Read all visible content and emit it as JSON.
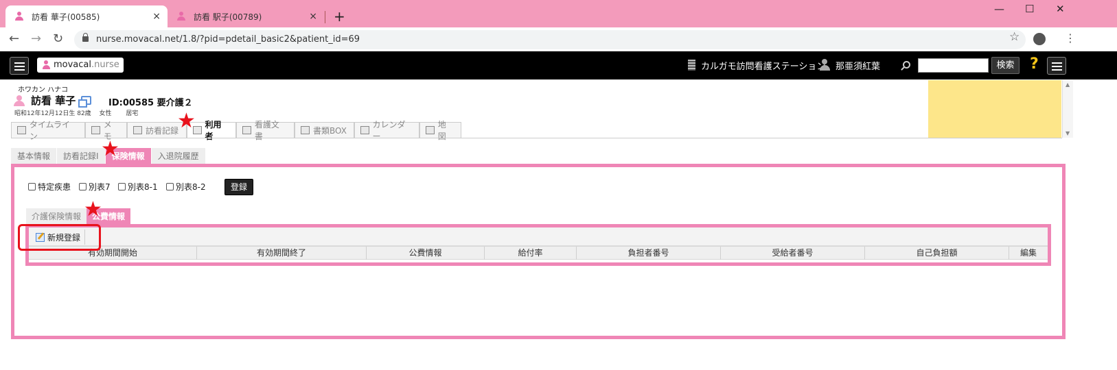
{
  "browser": {
    "tabs": [
      {
        "title": "訪看 華子(00585)",
        "close": "×"
      },
      {
        "title": "訪看 駅子(00789)",
        "close": "×"
      }
    ],
    "new_tab": "+",
    "window_controls": {
      "minimize": "—",
      "maximize": "☐",
      "close": "✕"
    },
    "nav": {
      "back": "←",
      "forward": "→",
      "reload": "↻"
    },
    "url": "nurse.movacal.net/1.8/?pid=pdetail_basic2&patient_id=69",
    "bookmark_star": "☆",
    "menu": "⋮"
  },
  "app": {
    "logo_main": "movacal",
    "logo_suffix": ".nurse",
    "station": "カルガモ訪問看護ステーション",
    "user": "那亜須紅葉",
    "search_button": "検索",
    "help": "?"
  },
  "patient": {
    "kana": "ホワカン ハナコ",
    "name": "訪看 華子",
    "id_care": "ID:00585 要介護２",
    "details": "昭和12年12月12日生 82歳　 女性　　 居宅"
  },
  "main_tabs": [
    {
      "label": "タイムライン",
      "active": false
    },
    {
      "label": "メモ",
      "active": false
    },
    {
      "label": "訪看記録",
      "active": false
    },
    {
      "label": "利用者",
      "active": true
    },
    {
      "label": "看護文書",
      "active": false
    },
    {
      "label": "書類BOX",
      "active": false
    },
    {
      "label": "カレンダー",
      "active": false
    },
    {
      "label": "地図",
      "active": false
    }
  ],
  "sub_tabs": [
    {
      "label": "基本情報",
      "active": false
    },
    {
      "label": "訪看記録I",
      "active": false
    },
    {
      "label": "保険情報",
      "active": true
    },
    {
      "label": "入退院履歴",
      "active": false
    }
  ],
  "checkboxes": [
    {
      "label": "特定疾患",
      "checked": false
    },
    {
      "label": "別表7",
      "checked": false
    },
    {
      "label": "別表8-1",
      "checked": false
    },
    {
      "label": "別表8-2",
      "checked": false
    }
  ],
  "register_button": "登録",
  "inner_tabs": [
    {
      "label": "介護保険情報",
      "active": false
    },
    {
      "label": "公費情報",
      "active": true
    }
  ],
  "new_register_button": "新規登録",
  "table_headers": [
    "有効期間開始",
    "有効期間終了",
    "公費情報",
    "給付率",
    "負担者番号",
    "受給者番号",
    "自己負担額",
    "編集"
  ],
  "annotation_marks": [
    "★",
    "★",
    "★"
  ],
  "colors": {
    "accent_pink": "#ef86b6",
    "tabstrip_pink": "#f39bbb",
    "annotation_red": "#e8121c",
    "note_yellow": "#fde68a"
  }
}
